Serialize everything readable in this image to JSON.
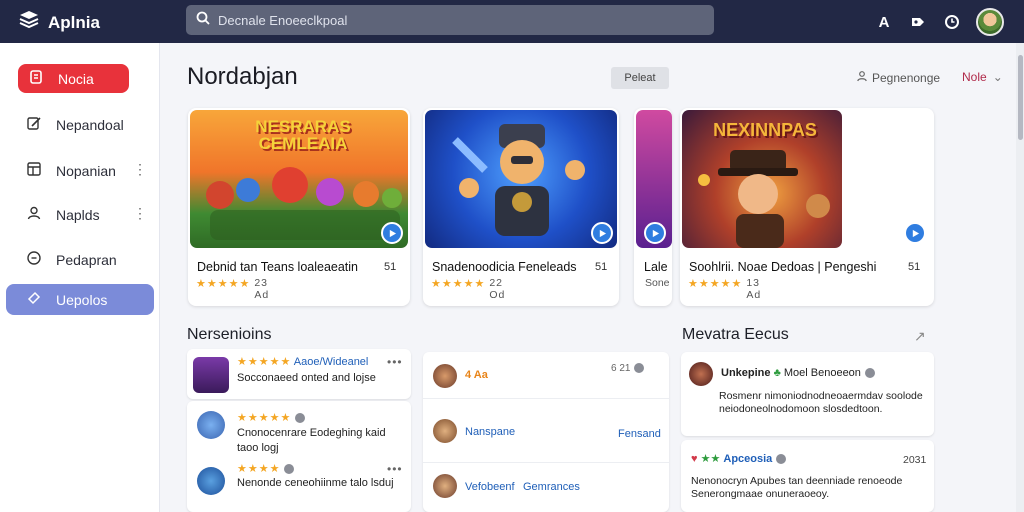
{
  "app": {
    "name": "Aplnia"
  },
  "search": {
    "placeholder": "Decnale Enoeeclkpoal"
  },
  "sidebar": {
    "items": [
      {
        "label": "Nocia"
      },
      {
        "label": "Nepandoal"
      },
      {
        "label": "Nopanian"
      },
      {
        "label": "Naplds"
      },
      {
        "label": "Pedapran"
      },
      {
        "label": "Uepolos"
      }
    ]
  },
  "page": {
    "title": "Nordabjan",
    "pill": "Peleat",
    "peer_label": "Pegnenonge",
    "mode_label": "Nole"
  },
  "featured": [
    {
      "art_text": "NESRARAS CEMLEAIA",
      "title": "Debnid tan Teans loaleaeatin",
      "rank": "51",
      "rating_text": "23 Ad"
    },
    {
      "art_text": "",
      "title": "Snadenoodicia Feneleads",
      "rank": "51",
      "rating_text": "22 Od"
    },
    {
      "art_text": "",
      "title": "Lale",
      "rank": "",
      "rating_text": "Sone"
    },
    {
      "art_text": "NEXINNPAS",
      "title": "Soohlrii. Noae Dedoas | Pengeshi",
      "rank": "51",
      "rating_text": "13 Ad"
    }
  ],
  "section_left": {
    "title": "Nersenioins",
    "rows": [
      {
        "title": "Aaoe/Wideanel",
        "text": "Socconaeed onted and lojse"
      },
      {
        "text": "Cnonocenrare Eodeghing kaid taoo logj"
      },
      {
        "text": "Nenonde ceneohiinme talo lsduj"
      }
    ]
  },
  "section_mid": {
    "rows": [
      {
        "badge": "4 Aa",
        "meta": "6 21"
      },
      {
        "name": "Nanspane",
        "right": "Fensand"
      },
      {
        "name": "Vefobeenf",
        "right": "Gemrances"
      }
    ]
  },
  "section_right": {
    "title": "Mevatra Eecus",
    "rows": [
      {
        "name": "Unkepine",
        "tag": "Moel Benoeeon",
        "text": "Rosmenr nimoniodnodneoaermdav soolodeneiodoneolnodomoon slosdedtoon."
      },
      {
        "name": "Apceosia",
        "count": "2031",
        "text": "Nenonocryn Apubes tan deenniade renoeode Senerongmaae onuneraoeoy."
      }
    ]
  },
  "colors": {
    "topbar": "#222845",
    "accent_red": "#e8323b",
    "selected": "#7b8bd9",
    "link_blue": "#1f5fb8"
  },
  "icons": [
    "app-logo-icon",
    "search-icon",
    "font-icon",
    "tag-icon",
    "clock-icon",
    "user-avatar"
  ]
}
